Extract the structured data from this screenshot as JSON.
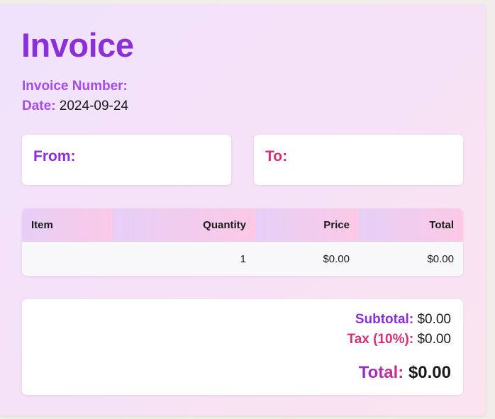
{
  "invoice": {
    "title": "Invoice",
    "number_label": "Invoice Number:",
    "number_value": "",
    "date_label": "Date:",
    "date_value": "2024-09-24"
  },
  "parties": {
    "from_label": "From:",
    "to_label": "To:"
  },
  "items_table": {
    "columns": [
      "Item",
      "Quantity",
      "Price",
      "Total"
    ],
    "rows": [
      {
        "item": "",
        "quantity": "1",
        "price": "$0.00",
        "total": "$0.00"
      }
    ]
  },
  "summary": {
    "subtotal_label": "Subtotal:",
    "subtotal_value": "$0.00",
    "tax_label": "Tax (10%):",
    "tax_value": "$0.00",
    "total_label": "Total:",
    "total_value": "$0.00"
  },
  "colors": {
    "purple": "#8b2fd9",
    "light_purple": "#a24ee8",
    "pink": "#d62f79"
  }
}
